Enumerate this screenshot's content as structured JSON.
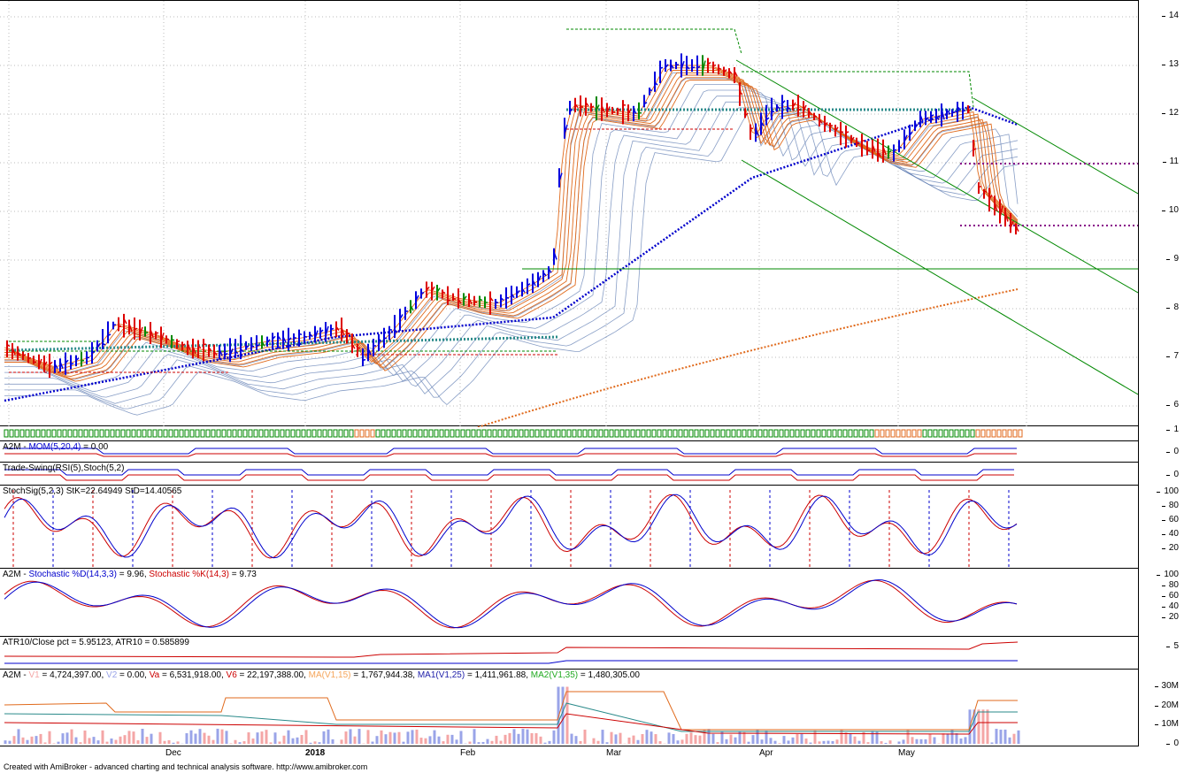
{
  "panels": {
    "price": {
      "y_ticks": [
        "14",
        "13",
        "12",
        "11",
        "10",
        "9",
        "8",
        "7",
        "6",
        "1"
      ]
    },
    "mom": {
      "label_a": "A2M - ",
      "label_b": "MOM(5,20,4)",
      "label_c": " = 0.00",
      "y_ticks": [
        "0"
      ]
    },
    "swing": {
      "label": "Trade-Swing(RSI(5),Stoch(5,2)",
      "y_ticks": [
        "0"
      ]
    },
    "stochsig": {
      "label": "StochSig(5,2,3) StK=22.64949 StD=14.40565",
      "y_ticks": [
        "100",
        "80",
        "60",
        "40",
        "20"
      ]
    },
    "stoch": {
      "label_a": "A2M - ",
      "label_b": "Stochastic %D(14,3,3)",
      "label_c": " = 9.96, ",
      "label_d": "Stochastic %K(14,3)",
      "label_e": " = 9.73",
      "y_ticks": [
        "100",
        "80",
        "60",
        "40",
        "20"
      ]
    },
    "atr": {
      "label": "ATR10/Close pct = 5.95123, ATR10 = 0.585899",
      "y_ticks": [
        "5"
      ]
    },
    "volume": {
      "parts": [
        {
          "text": "A2M - ",
          "color": "#000000"
        },
        {
          "text": "V1",
          "color": "#f4a6a6"
        },
        {
          "text": " = 4,724,397.00, ",
          "color": "#000000"
        },
        {
          "text": "V2",
          "color": "#9aa4e8"
        },
        {
          "text": " = 0.00, ",
          "color": "#000000"
        },
        {
          "text": "Va",
          "color": "#cc0000"
        },
        {
          "text": " = 6,531,918.00, ",
          "color": "#000000"
        },
        {
          "text": "V6",
          "color": "#cc0000"
        },
        {
          "text": " = 22,197,388.00, ",
          "color": "#000000"
        },
        {
          "text": "MA(V1,15)",
          "color": "#f5a55a"
        },
        {
          "text": " = 1,767,944.38, ",
          "color": "#000000"
        },
        {
          "text": "MA1(V1,25)",
          "color": "#2222aa"
        },
        {
          "text": " = 1,411,961.88, ",
          "color": "#000000"
        },
        {
          "text": "MA2(V1,35)",
          "color": "#22aa22"
        },
        {
          "text": " = 1,480,305.00",
          "color": "#000000"
        }
      ],
      "y_ticks": [
        "30M",
        "20M",
        "10M",
        "0"
      ]
    }
  },
  "x_labels": [
    "Dec",
    "2018",
    "Feb",
    "Mar",
    "Apr",
    "May"
  ],
  "footer": "Created with AmiBroker - advanced charting and technical analysis software. http://www.amibroker.com",
  "colors": {
    "up": "#0000dd",
    "down": "#dd0000",
    "neutral": "#008800",
    "ribbon_fast": "#e06a1c",
    "ribbon_slow": "#6a86b8",
    "channel": "#008800",
    "dotted": "#880088"
  }
}
